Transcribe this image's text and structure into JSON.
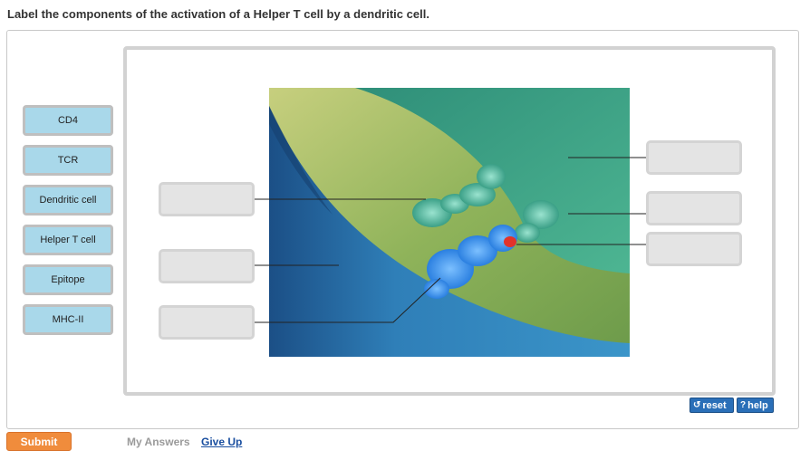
{
  "question": "Label the components of the activation of a Helper T cell by a dendritic cell.",
  "labels": [
    "CD4",
    "TCR",
    "Dendritic cell",
    "Helper T cell",
    "Epitope",
    "MHC-II"
  ],
  "controls": {
    "reset": "reset",
    "help": "help"
  },
  "footer": {
    "submit": "Submit",
    "my_answers": "My Answers",
    "give_up": "Give Up"
  },
  "colors": {
    "chip": "#a9d8ea",
    "submit": "#f08c3c",
    "control": "#2a6fb8"
  },
  "icons": {
    "reset": "reset-arrow-icon",
    "help": "question-mark-icon"
  }
}
